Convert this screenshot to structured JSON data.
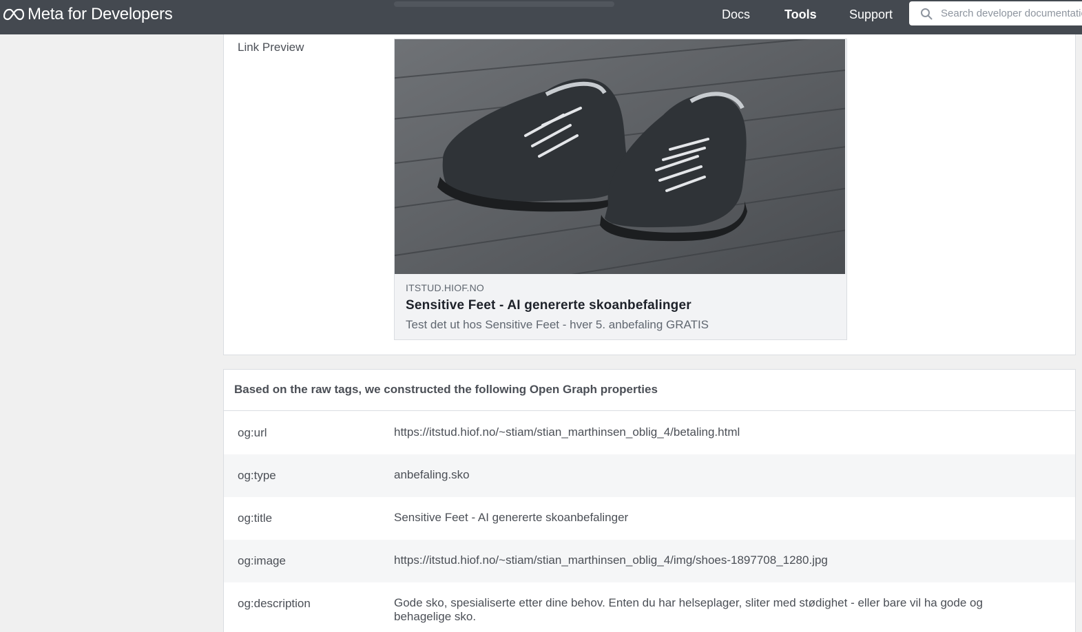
{
  "header": {
    "logo_text": "Meta for Developers",
    "nav": {
      "docs": "Docs",
      "tools": "Tools",
      "support": "Support"
    },
    "search": {
      "placeholder": "Search developer documentation"
    }
  },
  "preview": {
    "label": "Link Preview",
    "card": {
      "domain": "ITSTUD.HIOF.NO",
      "title": "Sensitive Feet - AI genererte skoanbefalinger",
      "description": "Test det ut hos Sensitive Feet - hver 5. anbefaling GRATIS"
    }
  },
  "properties": {
    "heading": "Based on the raw tags, we constructed the following Open Graph properties",
    "rows": [
      {
        "key": "og:url",
        "value": "https://itstud.hiof.no/~stiam/stian_marthinsen_oblig_4/betaling.html"
      },
      {
        "key": "og:type",
        "value": "anbefaling.sko"
      },
      {
        "key": "og:title",
        "value": "Sensitive Feet - AI genererte skoanbefalinger"
      },
      {
        "key": "og:image",
        "value": "https://itstud.hiof.no/~stiam/stian_marthinsen_oblig_4/img/shoes-1897708_1280.jpg"
      },
      {
        "key": "og:description",
        "value": "Gode sko, spesialiserte etter dine behov. Enten du har helseplager, sliter med stødighet - eller bare vil ha gode og behagelige sko."
      }
    ]
  },
  "colors": {
    "topbar": "#444950",
    "page_bg": "#f0f0f0",
    "row_alt": "#f5f6f7"
  }
}
